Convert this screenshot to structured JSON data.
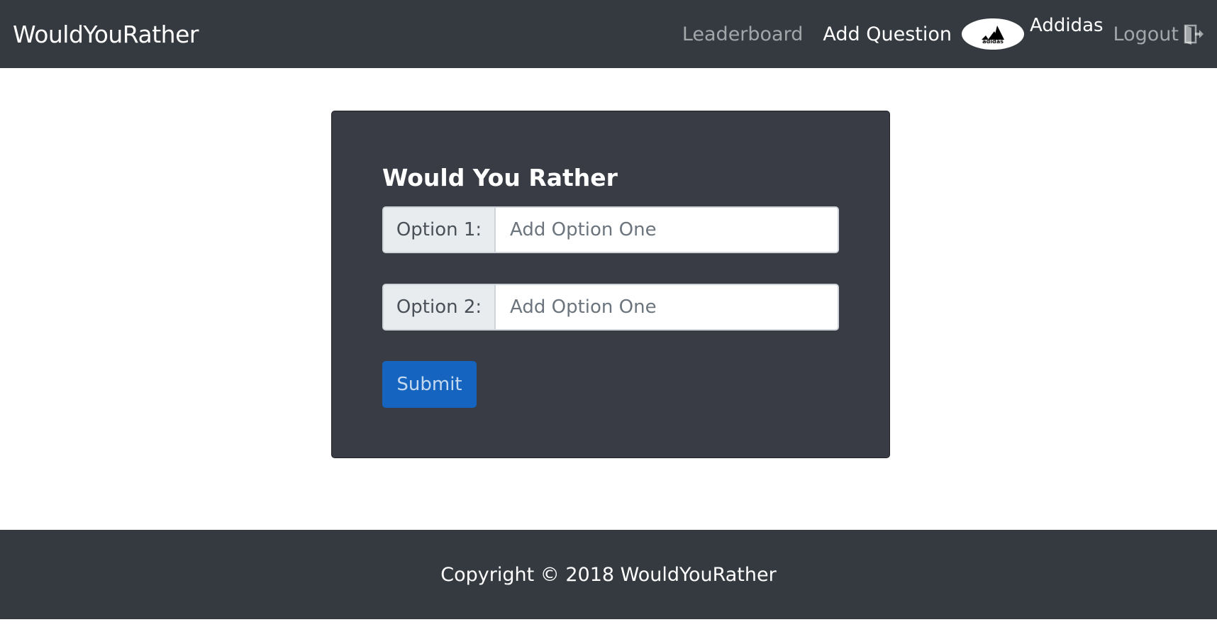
{
  "navbar": {
    "brand": "WouldYouRather",
    "links": {
      "leaderboard": "Leaderboard",
      "add_question": "Add Question"
    },
    "user": {
      "name": "Addidas",
      "avatar_text": "adidas",
      "avatar_icon": "adidas-logo"
    },
    "logout": {
      "label": "Logout",
      "icon": "door-exit-icon"
    }
  },
  "form": {
    "title": "Would You Rather",
    "option1": {
      "label": "Option 1:",
      "placeholder": "Add Option One",
      "value": ""
    },
    "option2": {
      "label": "Option 2:",
      "placeholder": "Add Option One",
      "value": ""
    },
    "submit_label": "Submit"
  },
  "footer": {
    "text": "Copyright © 2018 WouldYouRather"
  },
  "colors": {
    "navbar_bg": "#343a40",
    "card_bg": "#393c44",
    "primary": "#1565c0",
    "input_prefix_bg": "#e9ecef"
  }
}
